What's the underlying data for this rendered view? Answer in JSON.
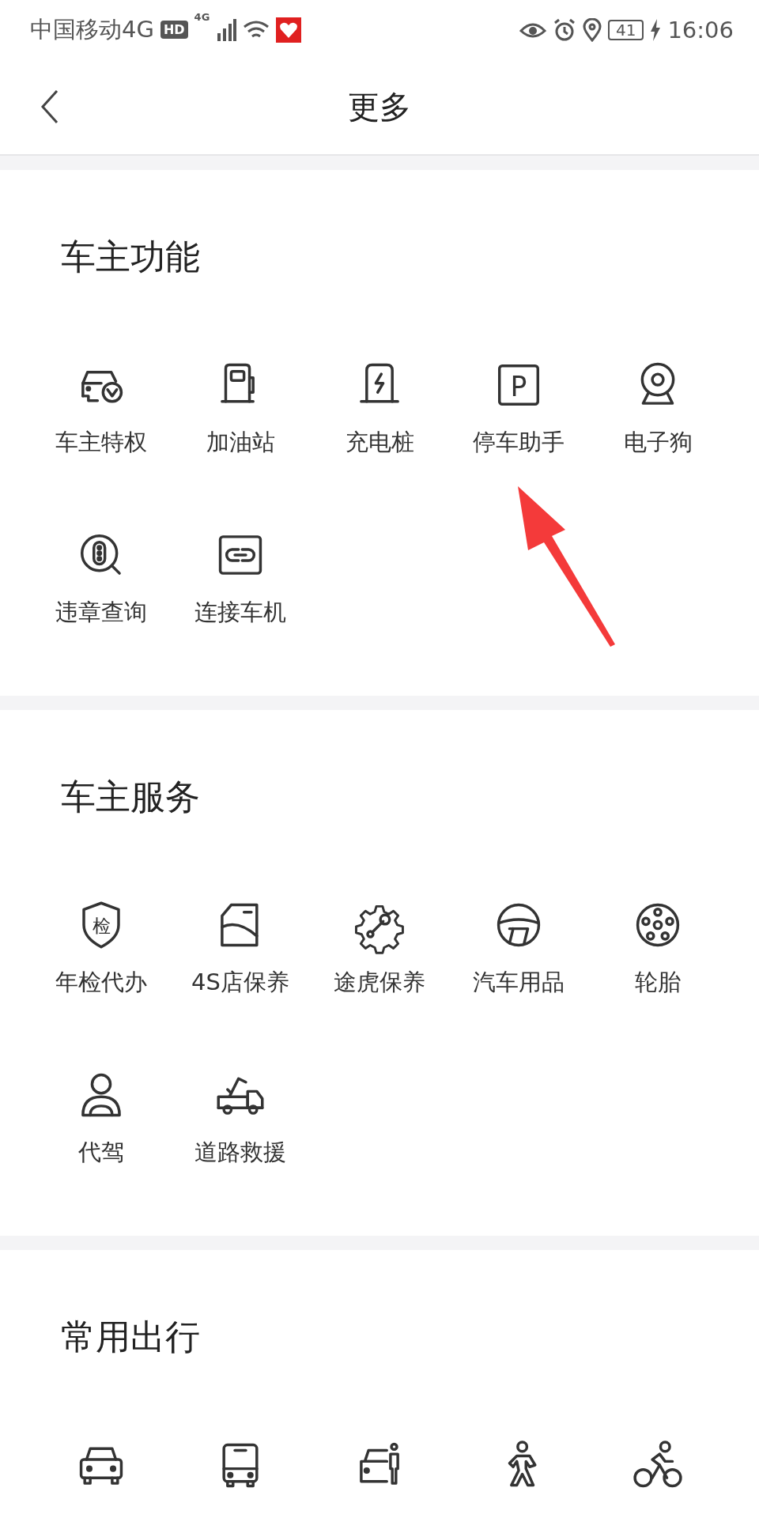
{
  "status_bar": {
    "carrier": "中国移动4G",
    "hd": "HD",
    "network": "4G",
    "battery": "41",
    "time": "16:06"
  },
  "header": {
    "title": "更多"
  },
  "sections": [
    {
      "title": "车主功能",
      "items": [
        {
          "label": "车主特权",
          "kind": "car-check"
        },
        {
          "label": "加油站",
          "kind": "fuel"
        },
        {
          "label": "充电桩",
          "kind": "charger"
        },
        {
          "label": "停车助手",
          "kind": "parking",
          "icon_text": "P"
        },
        {
          "label": "电子狗",
          "kind": "camera"
        },
        {
          "label": "违章查询",
          "kind": "violation"
        },
        {
          "label": "连接车机",
          "kind": "link"
        }
      ]
    },
    {
      "title": "车主服务",
      "items": [
        {
          "label": "年检代办",
          "kind": "shield",
          "icon_text": "检"
        },
        {
          "label": "4S店保养",
          "kind": "door"
        },
        {
          "label": "途虎保养",
          "kind": "gear"
        },
        {
          "label": "汽车用品",
          "kind": "wheel"
        },
        {
          "label": "轮胎",
          "kind": "tire"
        },
        {
          "label": "代驾",
          "kind": "driver"
        },
        {
          "label": "道路救援",
          "kind": "tow"
        }
      ]
    },
    {
      "title": "常用出行",
      "items": [
        {
          "kind": "car"
        },
        {
          "kind": "bus"
        },
        {
          "kind": "taxi"
        },
        {
          "kind": "walk"
        },
        {
          "kind": "bike"
        }
      ]
    }
  ],
  "overlay": {
    "kind": "arrow"
  }
}
